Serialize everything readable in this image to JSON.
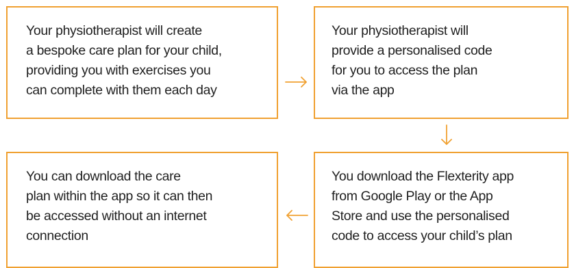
{
  "steps": [
    {
      "lines": [
        "Your physiotherapist will create",
        "a bespoke care plan for your child,",
        "providing you with exercises you",
        "can complete with them each day"
      ]
    },
    {
      "lines": [
        "Your physiotherapist will",
        "provide a personalised code",
        "for you to access the plan",
        "via the app"
      ]
    },
    {
      "lines": [
        "You download the Flexterity app",
        "from Google Play or the App",
        "Store and use the personalised",
        "code to access your child’s plan"
      ]
    },
    {
      "lines": [
        "You can download the care",
        "plan within the app so it can then",
        "be accessed without an internet",
        "connection"
      ]
    }
  ],
  "connectors": [
    {
      "from": 1,
      "to": 2,
      "direction": "right"
    },
    {
      "from": 2,
      "to": 3,
      "direction": "down"
    },
    {
      "from": 3,
      "to": 4,
      "direction": "left"
    }
  ],
  "colors": {
    "accent": "#f0a030",
    "text": "#1f1f1f",
    "background": "#ffffff"
  }
}
